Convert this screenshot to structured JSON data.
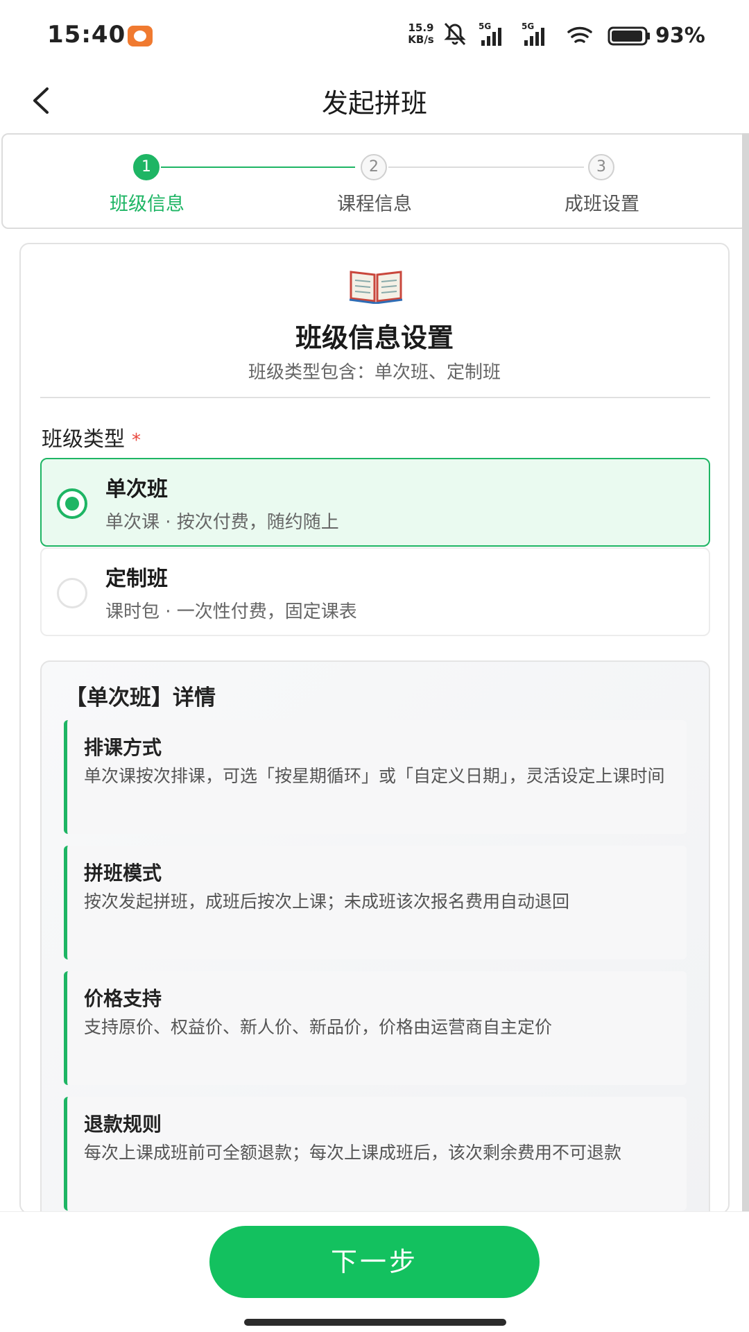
{
  "status_bar": {
    "time": "15:40",
    "net_speed_value": "15.9",
    "net_speed_unit": "KB/s",
    "battery": "93%",
    "icons": [
      "app-notification-icon",
      "mute-icon",
      "signal-5g-icon",
      "signal-5g-icon",
      "wifi-icon",
      "battery-icon"
    ]
  },
  "nav": {
    "title": "发起拼班"
  },
  "stepper": {
    "steps": [
      {
        "number": "1",
        "label": "班级信息",
        "state": "active"
      },
      {
        "number": "2",
        "label": "课程信息",
        "state": "pending"
      },
      {
        "number": "3",
        "label": "成班设置",
        "state": "pending"
      }
    ]
  },
  "card": {
    "icon": "open-book-icon",
    "title": "班级信息设置",
    "subtitle": "班级类型包含：单次班、定制班",
    "field_label": "班级类型",
    "required_mark": "*",
    "options": [
      {
        "title": "单次班",
        "desc": "单次课 · 按次付费，随约随上",
        "selected": true
      },
      {
        "title": "定制班",
        "desc": "课时包 · 一次性付费，固定课表",
        "selected": false
      }
    ]
  },
  "details": {
    "title": "【单次班】详情",
    "items": [
      {
        "name": "排课方式",
        "text": "单次课按次排课，可选「按星期循环」或「自定义日期」，灵活设定上课时间"
      },
      {
        "name": "拼班模式",
        "text": "按次发起拼班，成班后按次上课；未成班该次报名费用自动退回"
      },
      {
        "name": "价格支持",
        "text": "支持原价、权益价、新人价、新品价，价格由运营商自主定价"
      },
      {
        "name": "退款规则",
        "text": "每次上课成班前可全额退款；每次上课成班后，该次剩余费用不可退款"
      }
    ]
  },
  "footer": {
    "next_label": "下一步"
  },
  "colors": {
    "accent": "#1eb564",
    "button": "#13c15f",
    "selected_bg": "#eafaf0",
    "required": "#e8463c"
  }
}
